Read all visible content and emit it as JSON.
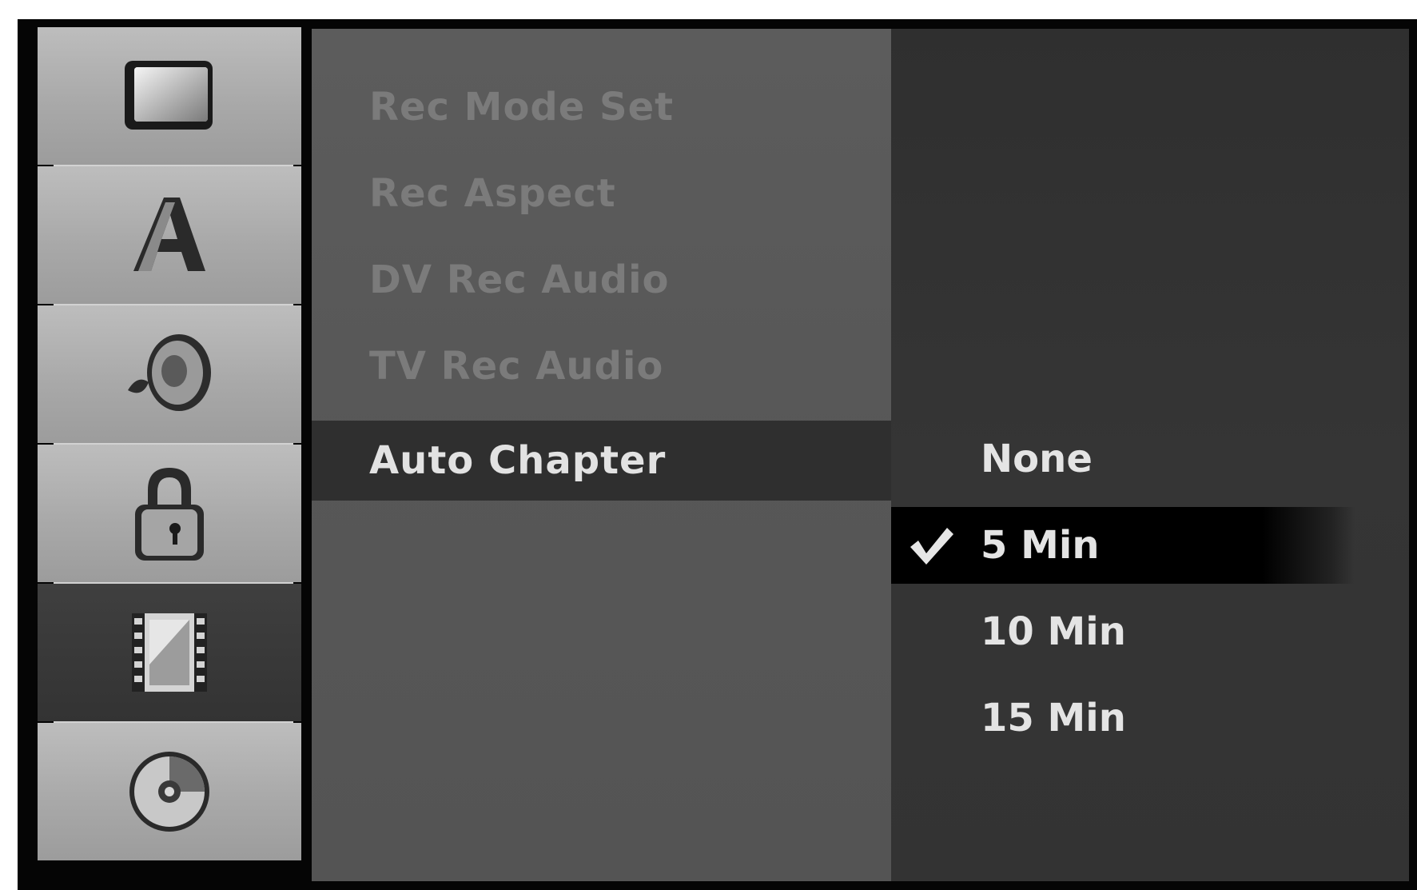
{
  "sidebar": {
    "icons": [
      {
        "name": "display-icon"
      },
      {
        "name": "language-icon"
      },
      {
        "name": "audio-icon"
      },
      {
        "name": "lock-icon"
      },
      {
        "name": "recording-icon",
        "selected": true
      },
      {
        "name": "disc-icon"
      }
    ]
  },
  "menu": {
    "items": [
      {
        "label": "Rec Mode Set"
      },
      {
        "label": "Rec Aspect"
      },
      {
        "label": "DV Rec Audio"
      },
      {
        "label": "TV Rec Audio"
      },
      {
        "label": "Auto Chapter"
      }
    ],
    "active_index": 4
  },
  "options": {
    "items": [
      {
        "label": "None"
      },
      {
        "label": "5 Min",
        "checked": true
      },
      {
        "label": "10 Min"
      },
      {
        "label": "15 Min"
      }
    ],
    "selected_index": 1
  },
  "colors": {
    "frame": "#050505",
    "tile": "#b0b0b0",
    "tile_selected": "#383838",
    "menu_panel": "#585858",
    "menu_text_dim": "#7b7b7b",
    "menu_text_active": "#e2e2e2",
    "options_panel": "#333333",
    "option_highlight": "#000000"
  }
}
